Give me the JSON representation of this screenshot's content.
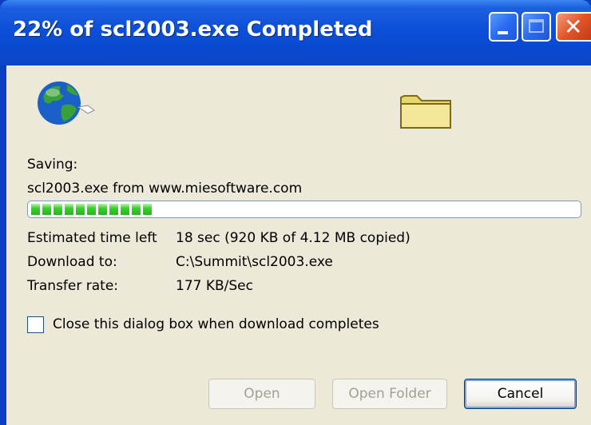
{
  "window": {
    "title": "22% of scl2003.exe Completed"
  },
  "dialog": {
    "saving_label": "Saving:",
    "file_source": "scl2003.exe from www.miesoftware.com",
    "progress_percent": 22,
    "est_label": "Estimated time left",
    "est_value": "18 sec (920 KB of 4.12 MB copied)",
    "download_to_label": "Download to:",
    "download_to_value": "C:\\Summit\\scl2003.exe",
    "transfer_rate_label": "Transfer rate:",
    "transfer_rate_value": "177 KB/Sec",
    "close_checkbox_label": "Close this dialog box when download completes",
    "close_checkbox_checked": false
  },
  "buttons": {
    "open": "Open",
    "open_folder": "Open Folder",
    "cancel": "Cancel"
  },
  "icons": {
    "globe": "globe-icon",
    "folder": "folder-icon",
    "minimize": "minimize-icon",
    "maximize": "maximize-icon",
    "close": "close-icon"
  },
  "colors": {
    "titlebar": "#0a48cf",
    "progress": "#26b51a",
    "client": "#ece9d8",
    "close_button": "#e2552a"
  }
}
